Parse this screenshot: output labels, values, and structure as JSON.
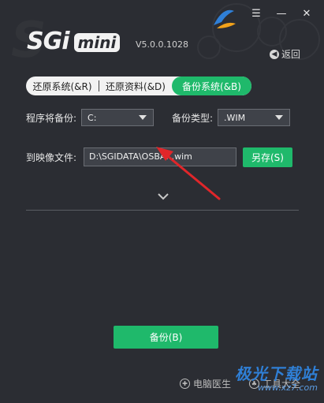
{
  "window": {
    "menu_glyph": "☰",
    "minimize_glyph": "—",
    "close_glyph": "✕"
  },
  "header": {
    "logo_text": "SGi",
    "logo_badge": "mini",
    "version": "V5.0.0.1028",
    "back_label": "返回"
  },
  "tabs": [
    {
      "label": "还原系统(&R)"
    },
    {
      "label": "还原资料(&D)"
    },
    {
      "label": "备份系统(&B)"
    }
  ],
  "form": {
    "source_label": "程序将备份:",
    "source_value": "C:",
    "type_label": "备份类型:",
    "type_value": ".WIM",
    "image_label": "到映像文件:",
    "image_path": "D:\\SGIDATA\\OSBAK.wim",
    "save_as_label": "另存(S)"
  },
  "actions": {
    "backup_label": "备份(B)"
  },
  "footer": {
    "doctor_label": "电脑医生",
    "tools_label": "工具大全"
  },
  "watermark": {
    "title": "极光下载站",
    "url": "www.xz7.com"
  },
  "colors": {
    "accent": "#1fb96b",
    "background": "#2b2d33",
    "arrow": "#e0262a"
  }
}
